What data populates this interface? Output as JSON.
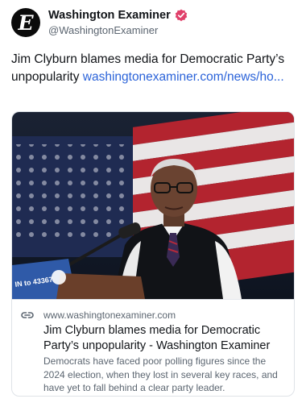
{
  "account": {
    "display_name": "Washington Examiner",
    "handle": "@WashingtonExaminer",
    "avatar_letter": "E",
    "verified_color": "#e0406a"
  },
  "post": {
    "text": "Jim Clyburn blames media for Democratic Party’s unpopularity ",
    "link_text": "washingtonexaminer.com/news/ho...",
    "link_color": "#2b63d9"
  },
  "link_card": {
    "icon": "link-icon",
    "domain": "www.washingtonexaminer.com",
    "title": "Jim Clyburn blames media for Democratic Party’s unpopularity - Washington Examiner",
    "description": "Democrats have faced poor polling figures since the 2024 election, when they lost in several key races, and have yet to fall behind a clear party leader.",
    "image": {
      "icon": "news-photo",
      "podium_text": "IN to 43367"
    }
  }
}
